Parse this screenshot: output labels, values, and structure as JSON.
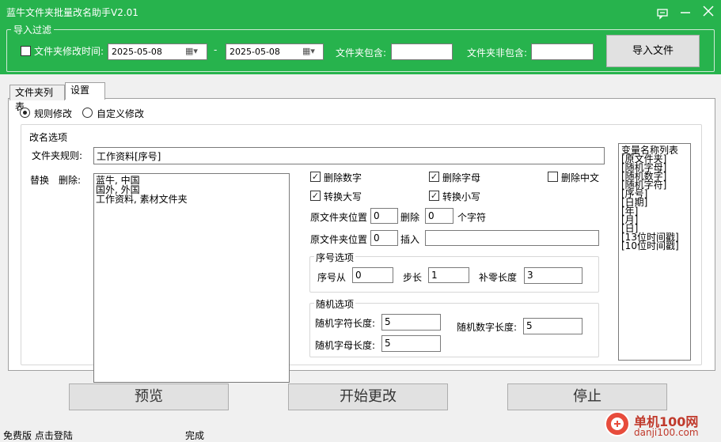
{
  "window": {
    "title": "蓝牛文件夹批量改名助手V2.01"
  },
  "import_filter": {
    "legend": "导入过滤",
    "modify_time_label": "文件夹修改时间:",
    "modify_time_checked": false,
    "date_from": "2025-05-08",
    "date_sep": "-",
    "date_to": "2025-05-08",
    "include_label": "文件夹包含:",
    "include_value": "",
    "exclude_label": "文件夹非包含:",
    "exclude_value": "",
    "import_button": "导入文件"
  },
  "tabs": [
    {
      "label": "文件夹列表",
      "active": false
    },
    {
      "label": "设置",
      "active": true
    }
  ],
  "mode": {
    "rule": "规则修改",
    "custom": "自定义修改",
    "selected": "rule"
  },
  "rename_options": {
    "legend": "改名选项",
    "rule_label": "文件夹规则:",
    "rule_value": "工作资料[序号]",
    "replace_label": "替换",
    "delete_label": "删除:",
    "replace_lines": [
      "蓝牛, 中国",
      "国外, 外国",
      "工作资料, 素材文件夹"
    ],
    "del_digits": {
      "label": "删除数字",
      "checked": true
    },
    "del_letters": {
      "label": "删除字母",
      "checked": true
    },
    "del_chinese": {
      "label": "删除中文",
      "checked": false
    },
    "to_upper": {
      "label": "转换大写",
      "checked": true
    },
    "to_lower": {
      "label": "转换小写",
      "checked": true
    },
    "pos_label": "原文件夹位置",
    "pos1_value": "0",
    "delete_word": "删除",
    "delete_count": "0",
    "chars_word": "个字符",
    "pos2_value": "0",
    "insert_word": "插入",
    "insert_value": ""
  },
  "seq_options": {
    "legend": "序号选项",
    "from_label": "序号从",
    "from_value": "0",
    "step_label": "步长",
    "step_value": "1",
    "pad_label": "补零长度",
    "pad_value": "3"
  },
  "random_options": {
    "legend": "随机选项",
    "char_len_label": "随机字符长度:",
    "char_len_value": "5",
    "num_len_label": "随机数字长度:",
    "num_len_value": "5",
    "letter_len_label": "随机字母长度:",
    "letter_len_value": "5"
  },
  "var_list": [
    "变量名称列表",
    "[原文件夹]",
    "[随机字母]",
    "[随机数字]",
    "[随机字符]",
    "[序号]",
    "[日期]",
    "[年]",
    "[月]",
    "[日]",
    "[13位时间戳]",
    "[10位时间戳]"
  ],
  "actions": {
    "preview": "预览",
    "start": "开始更改",
    "stop": "停止"
  },
  "status": {
    "left": "免费版 点击登陆",
    "middle": "完成"
  },
  "watermark": {
    "cn": "单机100网",
    "url": "danji100.com"
  },
  "colors": {
    "header_green": "#27b34d"
  }
}
